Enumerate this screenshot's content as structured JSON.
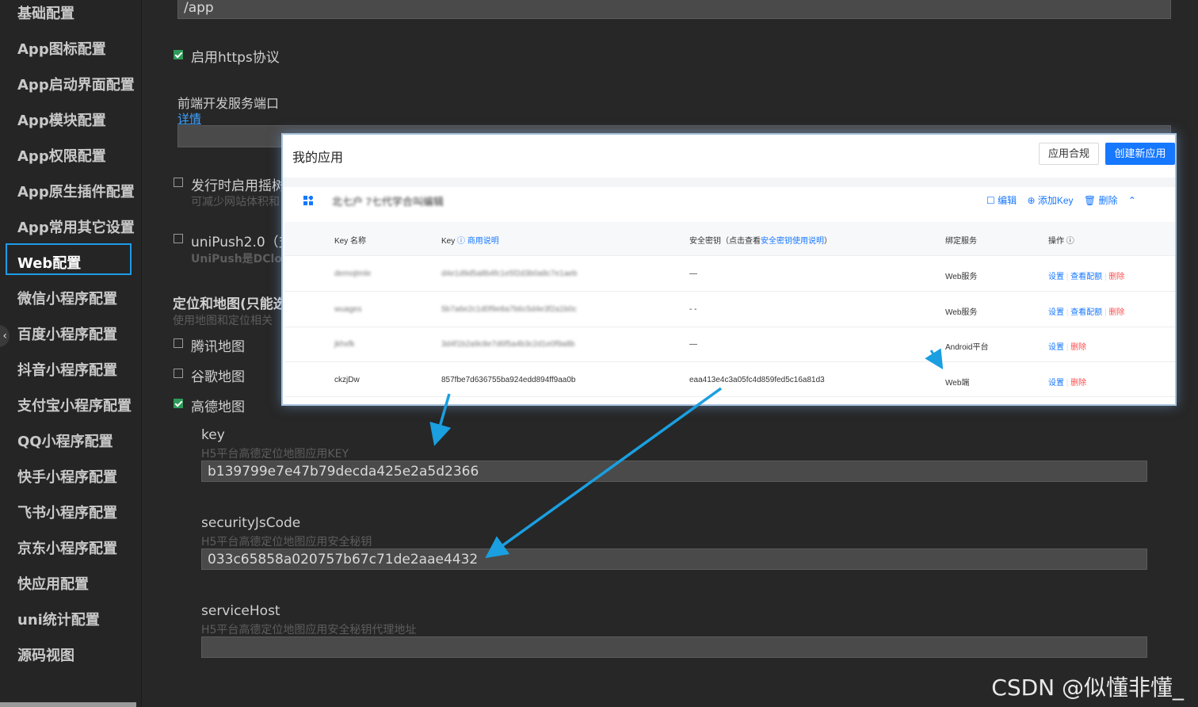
{
  "sidebar": {
    "items": [
      {
        "label": "基础配置"
      },
      {
        "label": "App图标配置"
      },
      {
        "label": "App启动界面配置"
      },
      {
        "label": "App模块配置"
      },
      {
        "label": "App权限配置"
      },
      {
        "label": "App原生插件配置"
      },
      {
        "label": "App常用其它设置"
      },
      {
        "label": "Web配置",
        "active": true
      },
      {
        "label": "微信小程序配置"
      },
      {
        "label": "百度小程序配置"
      },
      {
        "label": "抖音小程序配置"
      },
      {
        "label": "支付宝小程序配置"
      },
      {
        "label": "QQ小程序配置"
      },
      {
        "label": "快手小程序配置"
      },
      {
        "label": "飞书小程序配置"
      },
      {
        "label": "京东小程序配置"
      },
      {
        "label": "快应用配置"
      },
      {
        "label": "uni统计配置"
      },
      {
        "label": "源码视图"
      }
    ],
    "collapse_icon": "chevron-left-icon"
  },
  "main": {
    "base_path_value": "/app",
    "https": {
      "label": "启用https协议",
      "checked": true
    },
    "dev_port": {
      "label": "前端开发服务端口",
      "link": "详情",
      "value": ""
    },
    "treeshake": {
      "label": "发行时启用摇树",
      "hint": "可减少网站体积和",
      "checked": false
    },
    "unipush": {
      "label": "uniPush2.0（支",
      "hint": "UniPush是DClo",
      "checked": false
    },
    "map_section": {
      "title": "定位和地图(只能选",
      "hint": "使用地图和定位相关"
    },
    "maps": [
      {
        "label": "腾讯地图",
        "checked": false
      },
      {
        "label": "谷歌地图",
        "checked": false
      },
      {
        "label": "高德地图",
        "checked": true
      }
    ],
    "key": {
      "label": "key",
      "hint": "H5平台高德定位地图应用KEY",
      "value": "b139799e7e47b79decda425e2a5d2366"
    },
    "security": {
      "label": "securityJsCode",
      "hint": "H5平台高德定位地图应用安全秘钥",
      "value": "033c65858a020757b67c71de2aae4432"
    },
    "service_host": {
      "label": "serviceHost",
      "hint": "H5平台高德定位地图应用安全秘钥代理地址",
      "value": ""
    }
  },
  "popup": {
    "title": "我的应用",
    "btn_compliance": "应用合规",
    "btn_create": "创建新应用",
    "app_name": "北七户  7七代学合叫编辑",
    "actions": {
      "edit": "编辑",
      "add_key": "添加Key",
      "delete": "删除"
    },
    "columns": {
      "key_name": "Key 名称",
      "key": "Key",
      "key_help": "商用说明",
      "secret": "安全密钥（点击查看",
      "secret_link": "安全密钥使用说明",
      "secret_end": "）",
      "bind": "绑定服务",
      "ops": "操作"
    },
    "rows": [
      {
        "name": "demojtmle",
        "key": "d4e1d9d5a8b4fc1e5f2d3b0a8c7e1aeb",
        "secret": "—",
        "bind": "Web服务",
        "ops": [
          "设置",
          "查看配额",
          "删除"
        ],
        "blurred": true
      },
      {
        "name": "wuages",
        "key": "5b7a6e2c1d0f9e8a7b6c5d4e3f2a1b0c",
        "secret": "- -",
        "bind": "Web服务",
        "ops": [
          "设置",
          "查看配额",
          "删除"
        ],
        "blurred": true
      },
      {
        "name": "jkhxfk",
        "key": "3d4f1b2a9c8e7d6f5a4b3c2d1e0f9a8b",
        "secret": "—",
        "bind": "Android平台",
        "ops": [
          "设置",
          "删除"
        ],
        "blurred": true
      },
      {
        "name": "ckzjDw",
        "key": "857fbe7d636755ba924edd894ff9aa0b",
        "secret": "eaa413e4c3a05fc4d859fed5c16a81d3",
        "bind": "Web端",
        "ops": [
          "设置",
          "删除"
        ],
        "blurred": false
      }
    ]
  },
  "watermark": "CSDN @似懂非懂_",
  "colors": {
    "accent": "#1e9be8",
    "arrow": "#1a9fe0",
    "primary": "#1677ff",
    "danger": "#ff4d4f",
    "checkbox_on": "#2e9a59"
  }
}
